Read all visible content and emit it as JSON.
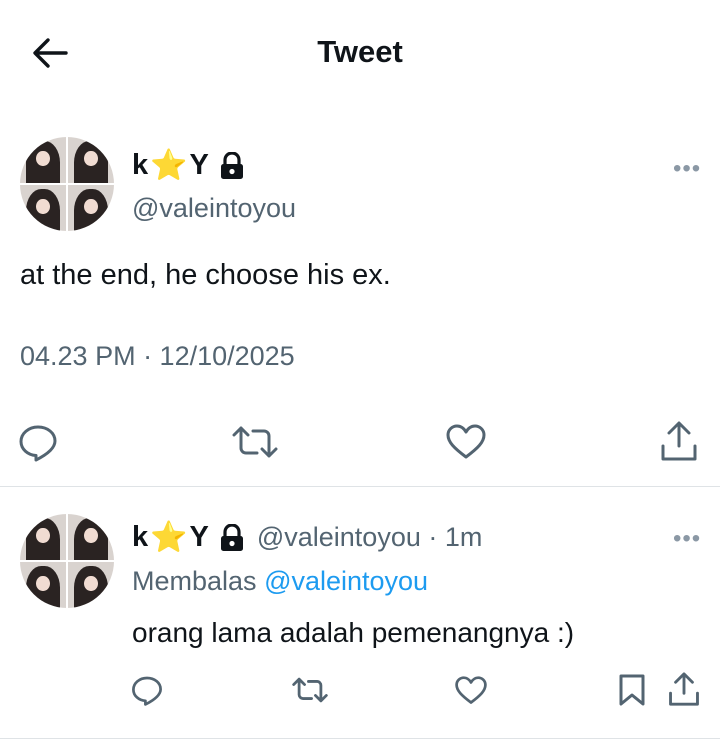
{
  "header": {
    "title": "Tweet",
    "back_icon": "arrow-left-icon"
  },
  "main_tweet": {
    "display_name_prefix": "k",
    "display_name_star": "⭐",
    "display_name_suffix": "Y",
    "lock_icon": "lock-icon",
    "handle": "@valeintoyou",
    "text": "at the end, he choose his ex.",
    "timestamp": "04.23 PM · 12/10/2025",
    "more": "•••",
    "actions": [
      "reply-icon",
      "retweet-icon",
      "like-icon",
      "share-icon"
    ]
  },
  "reply_tweet": {
    "display_name_prefix": "k",
    "display_name_star": "⭐",
    "display_name_suffix": "Y",
    "handle_time": "@valeintoyou · 1m",
    "replying_label": "Membalas",
    "replying_handle": "@valeintoyou",
    "text": "orang lama adalah pemenangnya :)",
    "more": "•••",
    "actions": [
      "reply-icon",
      "retweet-icon",
      "like-icon",
      "bookmark-icon",
      "share-icon"
    ]
  },
  "colors": {
    "text": "#0f1419",
    "secondary": "#536471",
    "link": "#1d9bf0",
    "star": "#f5b400"
  }
}
